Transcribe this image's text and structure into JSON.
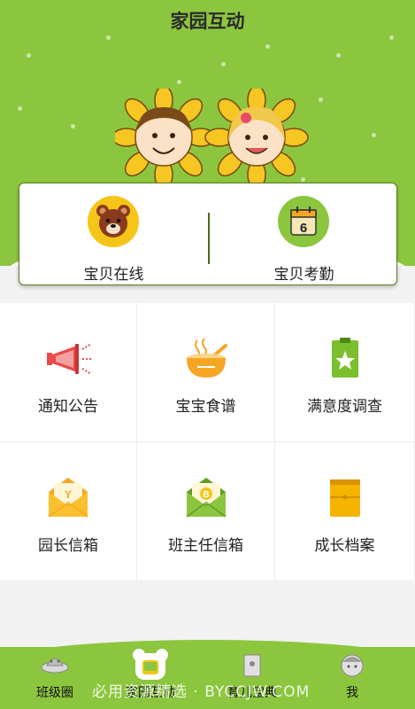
{
  "header": {
    "title": "家园互动"
  },
  "card": {
    "left": {
      "label": "宝贝在线"
    },
    "right": {
      "label": "宝贝考勤",
      "calendar_day": "6"
    }
  },
  "grid": [
    {
      "label": "通知公告"
    },
    {
      "label": "宝宝食谱"
    },
    {
      "label": "满意度调查"
    },
    {
      "label": "园长信箱",
      "letter": "Y"
    },
    {
      "label": "班主任信箱",
      "letter": "B"
    },
    {
      "label": "成长档案"
    }
  ],
  "tabs": [
    {
      "label": "班级圈"
    },
    {
      "label": "家园互动"
    },
    {
      "label": "育儿宝典"
    },
    {
      "label": "我"
    }
  ],
  "watermark": "必用资源精选 · BYCCJW.COM",
  "colors": {
    "brand_green": "#8cc63f",
    "orange": "#f5a623",
    "text": "#222222"
  }
}
